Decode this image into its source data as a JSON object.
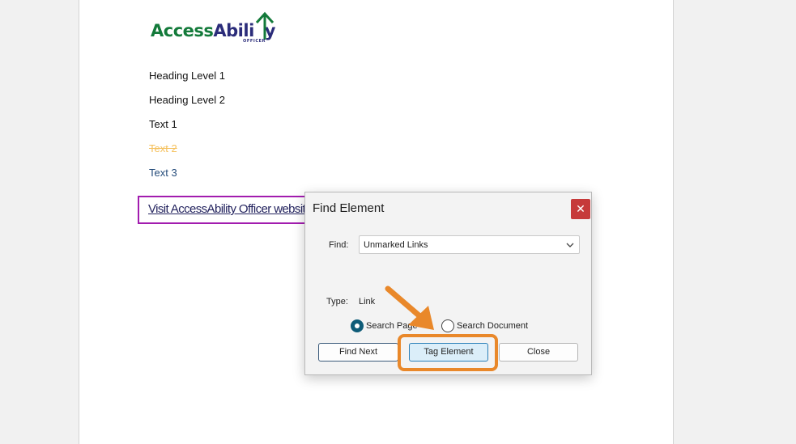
{
  "logo": {
    "part1": "Access",
    "part2": "Abili",
    "part3": "y",
    "subtitle": "OFFICER",
    "colors": {
      "green": "#137a3a",
      "navy": "#2b2c7a"
    }
  },
  "document": {
    "lines": [
      "Heading Level 1",
      "Heading Level 2",
      "Text 1",
      "Text 2",
      "Text 3"
    ],
    "link_text": "Visit AccessAbility Officer website"
  },
  "dialog": {
    "title": "Find Element",
    "close_glyph": "✕",
    "find_label": "Find:",
    "find_value": "Unmarked Links",
    "type_label": "Type:",
    "type_value": "Link",
    "radio_page": "Search Page",
    "radio_document": "Search Document",
    "buttons": {
      "find_next": "Find Next",
      "tag_element": "Tag Element",
      "close": "Close"
    }
  },
  "annotation": {
    "color": "#e9882a",
    "icon": "arrow-pointer-icon"
  }
}
